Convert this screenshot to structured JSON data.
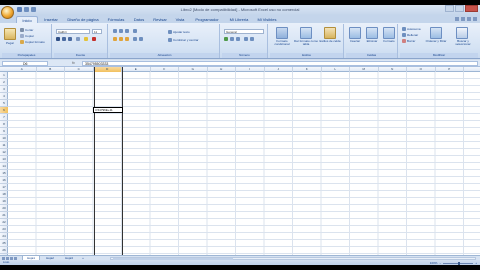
{
  "window": {
    "title": "Libro2 [Modo de compatibilidad] - Microsoft Excel uso no comercial"
  },
  "ribbon_tabs": [
    "Inicio",
    "Insertar",
    "Diseño de página",
    "Fórmulas",
    "Datos",
    "Revisar",
    "Vista",
    "Programador",
    "Mi Libreria",
    "Mi Visibles"
  ],
  "active_tab": "Inicio",
  "clipboard": {
    "paste_label": "Pegar",
    "cut": "Cortar",
    "copy": "Copiar",
    "format_painter": "Copiar formato",
    "group_label": "Portapapeles"
  },
  "font": {
    "font_name": "Calibri",
    "font_size": "11",
    "group_label": "Fuente"
  },
  "alignment": {
    "wrap_text": "Ajustar texto",
    "merge_center": "Combinar y centrar",
    "group_label": "Alineación"
  },
  "number": {
    "format": "General",
    "group_label": "Número"
  },
  "styles": {
    "conditional": "Formato condicional",
    "table": "Dar formato como tabla",
    "cell_styles": "Estilos de celda",
    "group_label": "Estilos"
  },
  "cells": {
    "insert": "Insertar",
    "delete": "Eliminar",
    "format": "Formato",
    "group_label": "Celdas"
  },
  "editing": {
    "autosum": "Autosuma",
    "fill": "Rellenar",
    "clear": "Borrar",
    "sort_filter": "Ordenar y filtrar",
    "find_select": "Buscar y seleccionar",
    "group_label": "Modificar"
  },
  "formula_bar": {
    "name_box": "D6",
    "fx": "fx",
    "formula": "354795503333"
  },
  "columns": [
    "A",
    "B",
    "C",
    "D",
    "E",
    "F",
    "G",
    "H",
    "I",
    "J",
    "K",
    "L",
    "M",
    "N",
    "O",
    "P"
  ],
  "rows": [
    "1",
    "2",
    "3",
    "4",
    "5",
    "6",
    "7",
    "8",
    "9",
    "10",
    "11",
    "12",
    "13",
    "14",
    "15",
    "16",
    "17",
    "18",
    "19",
    "20",
    "21",
    "22",
    "23",
    "24",
    "25",
    "26"
  ],
  "active_cell": {
    "column": "D",
    "row": "6",
    "display": "3.54796E+11"
  },
  "sheets": [
    "Hoja1",
    "Hoja2",
    "Hoja3"
  ],
  "active_sheet": "Hoja1",
  "status": {
    "mode": "Listo",
    "zoom": "100%"
  }
}
